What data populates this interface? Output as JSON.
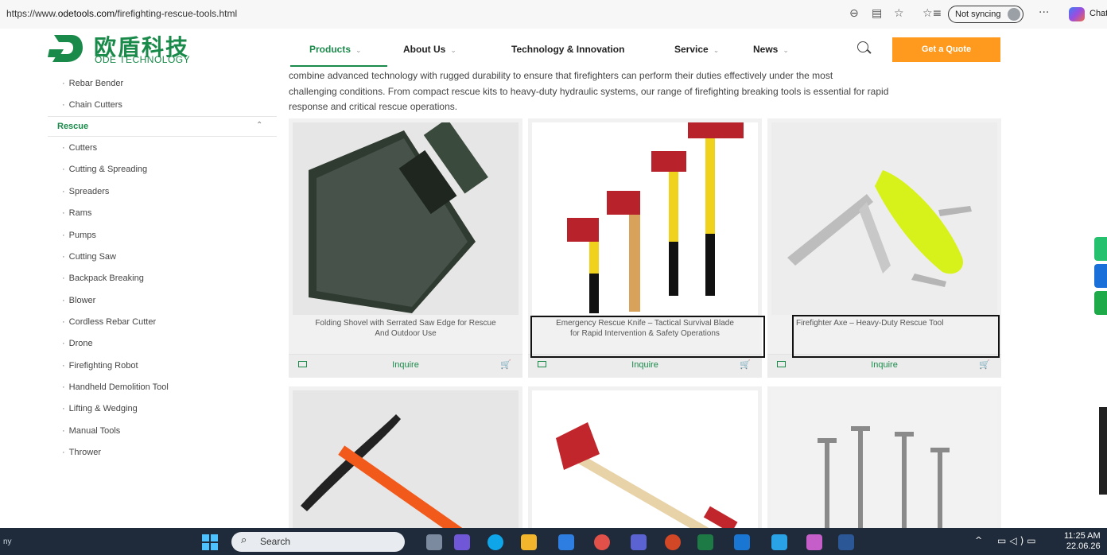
{
  "browser": {
    "url_prefix": "https://www.",
    "url_domain": "odetools.com",
    "url_path": "/firefighting-rescue-tools.html",
    "sync_label": "Not syncing",
    "chat_label": "Chat",
    "more_label": "···"
  },
  "header": {
    "logo_cn": "欧盾科技",
    "logo_en": "ODE TECHNOLOGY",
    "nav": [
      {
        "label": "Products"
      },
      {
        "label": "About Us"
      },
      {
        "label": "Technology & Innovation"
      },
      {
        "label": "Service"
      },
      {
        "label": "News"
      }
    ],
    "quote_button": "Get a Quote",
    "accent_color": "#1a8a4a",
    "button_color": "#ff9a1f"
  },
  "sidebar": {
    "top_items": [
      "Rebar Bender",
      "Chain Cutters"
    ],
    "section_label": "Rescue",
    "items": [
      "Cutters",
      "Cutting & Spreading",
      "Spreaders",
      "Rams",
      "Pumps",
      "Cutting Saw",
      "Backpack Breaking",
      "Blower",
      "Cordless Rebar Cutter",
      "Drone",
      "Firefighting Robot",
      "Handheld Demolition Tool",
      "Lifting & Wedging",
      "Manual Tools",
      "Thrower"
    ]
  },
  "intro": {
    "line1": "combine advanced technology with rugged durability to ensure that firefighters can perform their duties effectively under the most",
    "line2": "challenging conditions. From compact rescue kits to heavy-duty hydraulic systems, our range of firefighting breaking tools is essential for rapid",
    "line3": "response and critical rescue operations."
  },
  "products": [
    {
      "title_1": "Folding Shovel with Serrated Saw Edge for Rescue",
      "title_2": "And Outdoor Use",
      "inquire": "Inquire",
      "image": "folding-shovel"
    },
    {
      "title_1": "Emergency Rescue Knife – Tactical Survival Blade",
      "title_2": "for Rapid Intervention & Safety Operations",
      "inquire": "Inquire",
      "image": "axes-set"
    },
    {
      "title_1": "Firefighter Axe – Heavy-Duty Rescue Tool",
      "title_2": "",
      "inquire": "Inquire",
      "image": "rescue-knife"
    },
    {
      "image": "pickaxe"
    },
    {
      "image": "fire-axe"
    },
    {
      "image": "shovel-handles"
    }
  ],
  "taskbar": {
    "left_text": "ny",
    "search_label": "Search",
    "time": "11:25 AM",
    "date": "22.06.26"
  }
}
